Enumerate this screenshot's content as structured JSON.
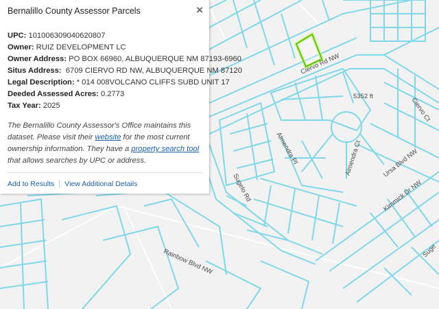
{
  "popup": {
    "title": "Bernalillo County Assessor Parcels",
    "close_symbol": "×",
    "fields": [
      {
        "label": "UPC:",
        "value": "101006309040620807"
      },
      {
        "label": "Owner:",
        "value": "RUIZ DEVELOPMENT LC"
      },
      {
        "label": "Owner Address:",
        "value": "PO BOX 66960, ALBUQUERQUE NM 87193-6960"
      },
      {
        "label": "Situs Address:",
        "value": "6709 CIERVO RD NW, ALBUQUERQUE NM 87120"
      },
      {
        "label": "Legal Description:",
        "value": "* 014 008VOLCANO CLIFFS SUBD UNIT 17"
      },
      {
        "label": "Deeded Assessed Acres:",
        "value": "0.2773"
      },
      {
        "label": "Tax Year:",
        "value": "2025"
      }
    ],
    "note": {
      "part1": "The Bernalillo County Assessor's Office maintains this dataset. Please visit their ",
      "link1": "website",
      "part2": " for the most current ownership information. They have a ",
      "link2": "property search tool",
      "part3": " that allows searches by UPC or address."
    },
    "actions": {
      "add_to_results": "Add to Results",
      "view_details": "View Additional Details"
    }
  },
  "map": {
    "street_labels": [
      "Ciervo Rd NW",
      "5352 ft",
      "Ciervo Ct",
      "Almendra Pl",
      "Almendra Ct",
      "Ursa Blvd NW",
      "Sugelo Rd",
      "Kimmick Dr NW",
      "Suge",
      "Rainbow Blvd NW"
    ],
    "colors": {
      "parcel_line": "#7fd8ea",
      "selected_outline": "#99ff33",
      "background": "#f2f2f2",
      "road_line": "#ffffff"
    }
  }
}
